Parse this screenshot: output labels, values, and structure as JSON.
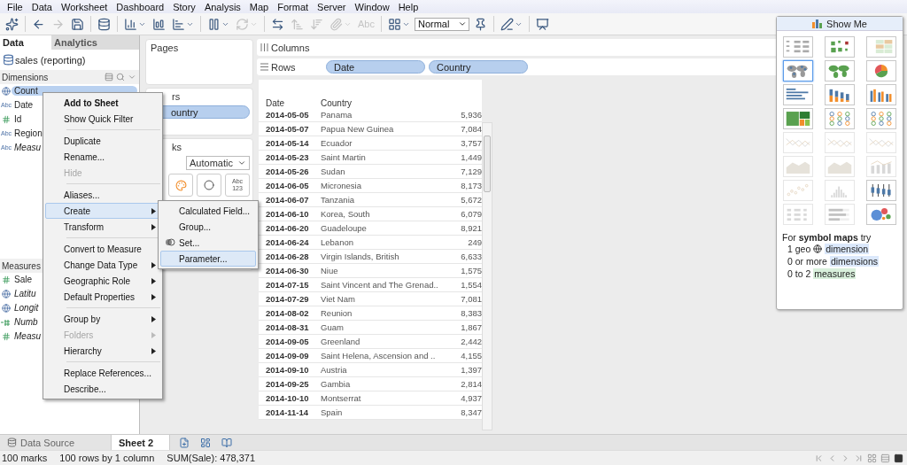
{
  "menu_bar": [
    "File",
    "Data",
    "Worksheet",
    "Dashboard",
    "Story",
    "Analysis",
    "Map",
    "Format",
    "Server",
    "Window",
    "Help"
  ],
  "toolbar": [
    {
      "kind": "icon",
      "disabled": false
    },
    {
      "kind": "separator"
    },
    {
      "kind": "icon",
      "disabled": false
    },
    {
      "kind": "icon",
      "disabled": true
    },
    {
      "kind": "icon",
      "disabled": false
    },
    {
      "kind": "separator"
    },
    {
      "kind": "icon",
      "disabled": false
    },
    {
      "kind": "separator"
    },
    {
      "kind": "icon-menu",
      "disabled": false
    },
    {
      "kind": "icon",
      "disabled": false
    },
    {
      "kind": "icon-menu",
      "disabled": false
    },
    {
      "kind": "separator"
    },
    {
      "kind": "icon-menu",
      "disabled": false
    },
    {
      "kind": "icon-menu",
      "disabled": true
    },
    {
      "kind": "separator"
    },
    {
      "kind": "icon",
      "disabled": false
    },
    {
      "kind": "icon",
      "disabled": true
    },
    {
      "kind": "icon",
      "disabled": true
    },
    {
      "kind": "icon-menu",
      "disabled": true
    },
    {
      "kind": "text",
      "label": "Abc",
      "disabled": true
    },
    {
      "kind": "separator"
    },
    {
      "kind": "icon-menu",
      "disabled": false
    },
    {
      "kind": "dropdown",
      "value": "Normal"
    },
    {
      "kind": "icon",
      "disabled": false
    },
    {
      "kind": "separator"
    },
    {
      "kind": "icon-menu",
      "disabled": false
    },
    {
      "kind": "separator"
    },
    {
      "kind": "icon",
      "disabled": false
    }
  ],
  "side_tabs": [
    {
      "label": "Data",
      "selected": true
    },
    {
      "label": "Analytics",
      "selected": false
    }
  ],
  "data_source": "sales (reporting)",
  "dimensions": {
    "title": "Dimensions",
    "fields": [
      {
        "kind": "geo",
        "name": "Count",
        "italic": false,
        "selected": true
      },
      {
        "kind": "abc",
        "type_label": "Abc",
        "name": "Date",
        "italic": false,
        "selected": false
      },
      {
        "kind": "number",
        "name": "Id",
        "italic": false,
        "selected": false
      },
      {
        "kind": "abc",
        "type_label": "Abc",
        "name": "Region",
        "italic": false,
        "selected": false
      },
      {
        "kind": "abc",
        "type_label": "Abc",
        "name": "Measu",
        "italic": true,
        "selected": false
      }
    ]
  },
  "measures": {
    "title": "Measures",
    "fields": [
      {
        "kind": "number",
        "name": "Sale",
        "italic": false
      },
      {
        "kind": "geo",
        "name": "Latitu",
        "italic": true
      },
      {
        "kind": "geo",
        "name": "Longit",
        "italic": true
      },
      {
        "kind": "calc-number",
        "name": "Numb",
        "italic": true
      },
      {
        "kind": "number",
        "name": "Measu",
        "italic": true
      }
    ]
  },
  "pages": {
    "title": "Pages"
  },
  "filters": {
    "title": "rs",
    "pills": [
      "ountry"
    ]
  },
  "marks": {
    "title": "ks",
    "mark_type": "Automatic",
    "buttons": [
      {
        "kind": "color"
      },
      {
        "kind": "size"
      },
      {
        "kind": "text",
        "glyph_lines": [
          "Abc",
          "123"
        ]
      }
    ]
  },
  "shelves": [
    {
      "kind": "columns",
      "label": "Columns"
    },
    {
      "kind": "rows",
      "label": "Rows",
      "pills": [
        "Date",
        "Country"
      ]
    }
  ],
  "table": {
    "columns": [
      "Date",
      "Country"
    ],
    "rows": [
      [
        "2014-05-05",
        "Panama",
        "5,936"
      ],
      [
        "2014-05-07",
        "Papua New Guinea",
        "7,084"
      ],
      [
        "2014-05-14",
        "Ecuador",
        "3,757"
      ],
      [
        "2014-05-23",
        "Saint Martin",
        "1,449"
      ],
      [
        "2014-05-26",
        "Sudan",
        "7,129"
      ],
      [
        "2014-06-05",
        "Micronesia",
        "8,173"
      ],
      [
        "2014-06-07",
        "Tanzania",
        "5,672"
      ],
      [
        "2014-06-10",
        "Korea, South",
        "6,079"
      ],
      [
        "2014-06-20",
        "Guadeloupe",
        "8,921"
      ],
      [
        "2014-06-24",
        "Lebanon",
        "249"
      ],
      [
        "2014-06-28",
        "Virgin Islands, British",
        "6,633"
      ],
      [
        "2014-06-30",
        "Niue",
        "1,575"
      ],
      [
        "2014-07-15",
        "Saint Vincent and The Grenad..",
        "1,554"
      ],
      [
        "2014-07-29",
        "Viet Nam",
        "7,081"
      ],
      [
        "2014-08-02",
        "Reunion",
        "8,383"
      ],
      [
        "2014-08-31",
        "Guam",
        "1,867"
      ],
      [
        "2014-09-05",
        "Greenland",
        "2,442"
      ],
      [
        "2014-09-09",
        "Saint Helena, Ascension and ..",
        "4,155"
      ],
      [
        "2014-09-10",
        "Austria",
        "1,397"
      ],
      [
        "2014-09-25",
        "Gambia",
        "2,814"
      ],
      [
        "2014-10-10",
        "Montserrat",
        "4,937"
      ],
      [
        "2014-11-14",
        "Spain",
        "8,347"
      ]
    ]
  },
  "context_menu": [
    {
      "kind": "item",
      "label": "Add to Sheet",
      "default": true,
      "disabled": false,
      "submenu": false,
      "selected": false
    },
    {
      "kind": "item",
      "label": "Show Quick Filter",
      "default": false,
      "disabled": false,
      "submenu": false,
      "selected": false
    },
    {
      "kind": "separator"
    },
    {
      "kind": "item",
      "label": "Duplicate",
      "default": false,
      "disabled": false,
      "submenu": false,
      "selected": false
    },
    {
      "kind": "item",
      "label": "Rename...",
      "default": false,
      "disabled": false,
      "submenu": false,
      "selected": false
    },
    {
      "kind": "item",
      "label": "Hide",
      "default": false,
      "disabled": true,
      "submenu": false,
      "selected": false
    },
    {
      "kind": "separator"
    },
    {
      "kind": "item",
      "label": "Aliases...",
      "default": false,
      "disabled": false,
      "submenu": false,
      "selected": false
    },
    {
      "kind": "item",
      "label": "Create",
      "default": false,
      "disabled": false,
      "submenu": true,
      "selected": true
    },
    {
      "kind": "item",
      "label": "Transform",
      "default": false,
      "disabled": false,
      "submenu": true,
      "selected": false
    },
    {
      "kind": "separator"
    },
    {
      "kind": "item",
      "label": "Convert to Measure",
      "default": false,
      "disabled": false,
      "submenu": false,
      "selected": false
    },
    {
      "kind": "item",
      "label": "Change Data Type",
      "default": false,
      "disabled": false,
      "submenu": true,
      "selected": false
    },
    {
      "kind": "item",
      "label": "Geographic Role",
      "default": false,
      "disabled": false,
      "submenu": true,
      "selected": false
    },
    {
      "kind": "item",
      "label": "Default Properties",
      "default": false,
      "disabled": false,
      "submenu": true,
      "selected": false
    },
    {
      "kind": "separator"
    },
    {
      "kind": "item",
      "label": "Group by",
      "default": false,
      "disabled": false,
      "submenu": true,
      "selected": false
    },
    {
      "kind": "item",
      "label": "Folders",
      "default": false,
      "disabled": true,
      "submenu": true,
      "selected": false
    },
    {
      "kind": "item",
      "label": "Hierarchy",
      "default": false,
      "disabled": false,
      "submenu": true,
      "selected": false
    },
    {
      "kind": "separator"
    },
    {
      "kind": "item",
      "label": "Replace References...",
      "default": false,
      "disabled": false,
      "submenu": false,
      "selected": false
    },
    {
      "kind": "item",
      "label": "Describe...",
      "default": false,
      "disabled": false,
      "submenu": false,
      "selected": false
    }
  ],
  "submenu": [
    {
      "kind": "plain",
      "label": "Calculated Field...",
      "selected": false
    },
    {
      "kind": "plain",
      "label": "Group...",
      "selected": false
    },
    {
      "kind": "set",
      "label": "Set...",
      "selected": false
    },
    {
      "kind": "plain",
      "label": "Parameter...",
      "selected": true
    }
  ],
  "show_me": {
    "title": "Show Me",
    "chart_types": [
      {
        "kind": "text-table",
        "selected": false,
        "available": true
      },
      {
        "kind": "heat-map",
        "selected": false,
        "available": true
      },
      {
        "kind": "highlight-table",
        "selected": false,
        "available": true
      },
      {
        "kind": "symbol-map",
        "selected": true,
        "available": true
      },
      {
        "kind": "filled-map",
        "selected": false,
        "available": true
      },
      {
        "kind": "pie",
        "selected": false,
        "available": true
      },
      {
        "kind": "horizontal-bars",
        "selected": false,
        "available": true
      },
      {
        "kind": "stacked-bars",
        "selected": false,
        "available": true
      },
      {
        "kind": "side-by-side-bars",
        "selected": false,
        "available": true
      },
      {
        "kind": "treemap",
        "selected": false,
        "available": true
      },
      {
        "kind": "circle-views",
        "selected": false,
        "available": true
      },
      {
        "kind": "side-by-side-circles",
        "selected": false,
        "available": true
      },
      {
        "kind": "continuous-lines",
        "selected": false,
        "available": false
      },
      {
        "kind": "discrete-lines",
        "selected": false,
        "available": false
      },
      {
        "kind": "dual-lines",
        "selected": false,
        "available": false
      },
      {
        "kind": "continuous-area",
        "selected": false,
        "available": false
      },
      {
        "kind": "discrete-area",
        "selected": false,
        "available": false
      },
      {
        "kind": "dual-combination",
        "selected": false,
        "available": false
      },
      {
        "kind": "scatter",
        "selected": false,
        "available": false
      },
      {
        "kind": "histogram",
        "selected": false,
        "available": false
      },
      {
        "kind": "box-whisker",
        "selected": false,
        "available": true
      },
      {
        "kind": "gantt",
        "selected": false,
        "available": false
      },
      {
        "kind": "bullet",
        "selected": false,
        "available": false
      },
      {
        "kind": "packed-bubbles",
        "selected": false,
        "available": true
      }
    ],
    "hint": "For **symbol maps** try",
    "requirements": [
      {
        "kind": "geo-dimension",
        "count": "1 geo",
        "term": "dimension"
      },
      {
        "kind": "dimension",
        "count": "0 or more",
        "term": "dimensions"
      },
      {
        "kind": "measure",
        "count": "0 to 2",
        "term": "measures"
      }
    ]
  },
  "sheet_tabs": [
    {
      "kind": "data-source",
      "label": "Data Source",
      "selected": false
    },
    {
      "kind": "sheet",
      "label": "Sheet 2",
      "selected": true
    }
  ],
  "status_bar": [
    "100 marks",
    "100 rows by 1 column",
    "SUM(Sale): 478,371"
  ]
}
